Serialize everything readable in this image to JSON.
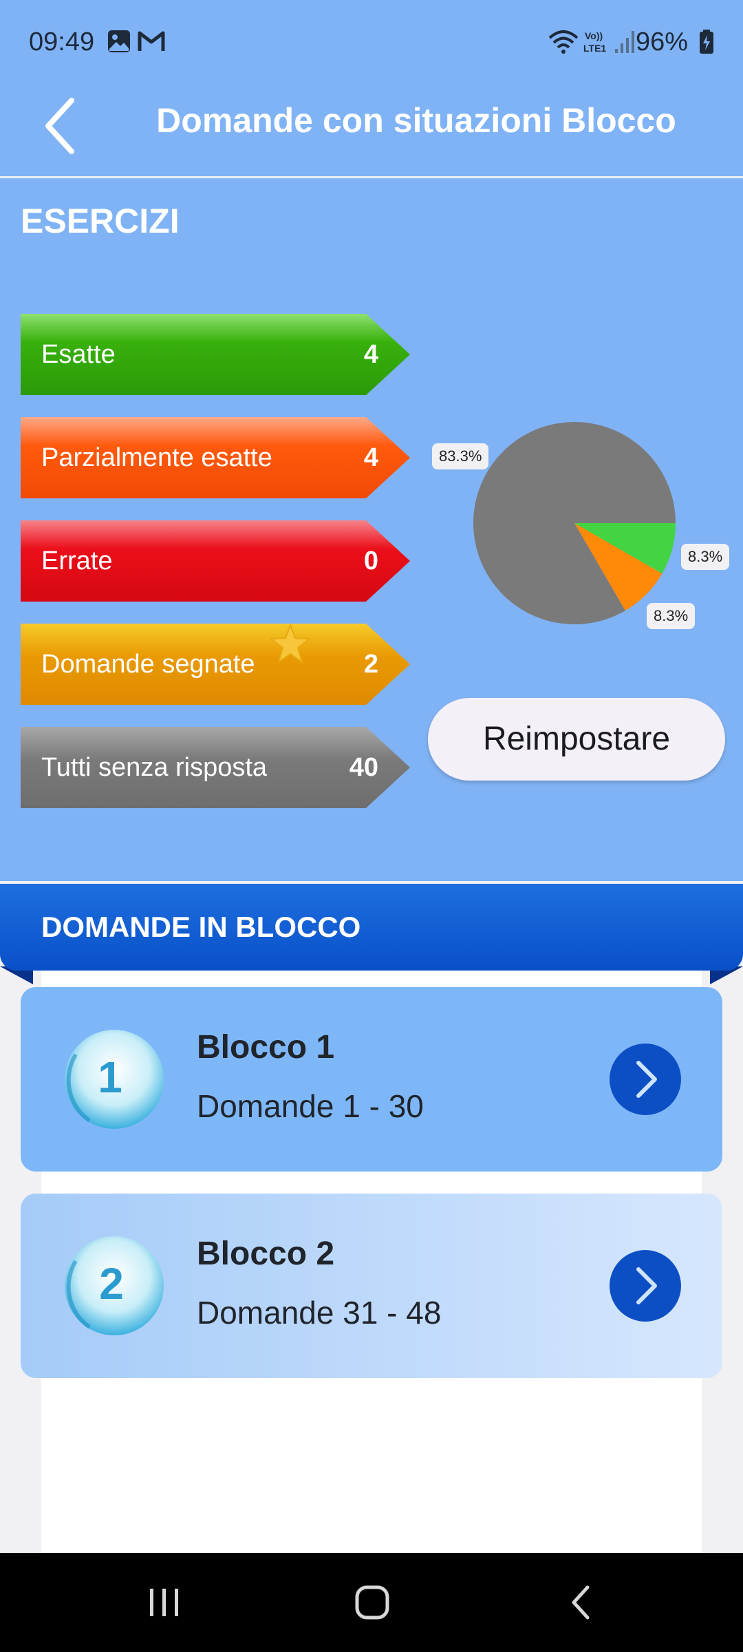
{
  "status_bar": {
    "time": "09:49",
    "battery": "96%",
    "icons": [
      "gallery-icon",
      "gmail-icon",
      "wifi-icon",
      "volte-icon",
      "signal-icon",
      "battery-charging-icon"
    ]
  },
  "header": {
    "title": "Domande con situazioni Blocco",
    "back_icon": "chevron-left-icon"
  },
  "exercises": {
    "title": "ESERCIZI",
    "stats": [
      {
        "label": "Esatte",
        "value": "4",
        "color": "#38b00c"
      },
      {
        "label": "Parzialmente esatte",
        "value": "4",
        "color": "#ff5a0d"
      },
      {
        "label": "Errate",
        "value": "0",
        "color": "#eb0f1a"
      },
      {
        "label": "Domande segnate",
        "value": "2",
        "color": "#e99a03",
        "icon": "star-icon"
      },
      {
        "label": "Tutti senza risposta",
        "value": "40",
        "color": "#7a7a7a"
      }
    ],
    "reset_label": "Reimpostare"
  },
  "chart_data": {
    "type": "pie",
    "slices": [
      {
        "label": "83.3%",
        "value": 83.3,
        "color": "#7a7a7a"
      },
      {
        "label": "8.3%",
        "value": 8.3,
        "color": "#42d442"
      },
      {
        "label": "8.3%",
        "value": 8.3,
        "color": "#ff8a0a"
      }
    ]
  },
  "blocks": {
    "title": "DOMANDE IN BLOCCO",
    "items": [
      {
        "number": "1",
        "title": "Blocco 1",
        "subtitle": "Domande 1 - 30"
      },
      {
        "number": "2",
        "title": "Blocco 2",
        "subtitle": "Domande 31 - 48"
      }
    ]
  },
  "nav_bar": {
    "icons": [
      "recent-apps-icon",
      "home-icon",
      "back-icon"
    ]
  }
}
